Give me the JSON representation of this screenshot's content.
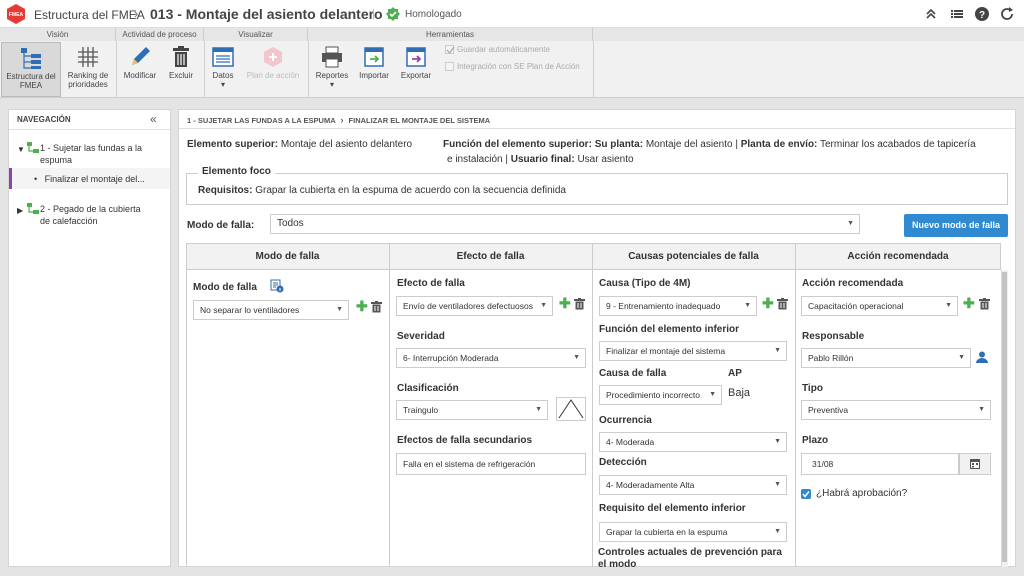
{
  "app": {
    "title": "Estructura del FMEA",
    "crumb_sep": "›",
    "page_title": "013 - Montaje del asiento delantero",
    "pipe": "|",
    "status": "Homologado",
    "logo_text": "FMEA"
  },
  "ribbon": {
    "groups": [
      "Visión",
      "Actividad de proceso",
      "Visualizar",
      "Herramientas"
    ],
    "buttons": {
      "estructura": [
        "Estructura del",
        "FMEA"
      ],
      "ranking": [
        "Ranking de",
        "prioridades"
      ],
      "modificar": "Modificar",
      "excluir": "Excluir",
      "datos": "Datos",
      "plan": "Plan de acción",
      "reportes": "Reportes",
      "importar": "Importar",
      "exportar": "Exportar"
    },
    "checks": [
      "Guardar automáticamente",
      "Integración con SE Plan de Acción"
    ]
  },
  "nav": {
    "title": "NAVEGACIÓN",
    "collapse": "«",
    "items": [
      {
        "label_1": "1 - Sujetar las fundas a la",
        "label_2": "espuma"
      },
      {
        "label_1": "Finalizar el montaje del..."
      },
      {
        "label_1": "2 - Pegado de la cubierta",
        "label_2": "de calefacción"
      }
    ]
  },
  "main": {
    "breadcrumb_1": "1 - SUJETAR LAS FUNDAS A LA ESPUMA",
    "breadcrumb_sep": "›",
    "breadcrumb_2": "FINALIZAR EL MONTAJE DEL SISTEMA",
    "superior_label": "Elemento superior:",
    "superior_value": "Montaje del asiento delantero",
    "funcion_label": "Función del elemento superior:",
    "su_planta_label": "Su planta:",
    "su_planta_value": "Montaje del asiento |",
    "planta_envio_label": "Planta de envío:",
    "planta_envio_value": "Terminar los acabados de tapicería",
    "line2_value": "e instalación |",
    "usuario_label": "Usuario final:",
    "usuario_value": "Usar asiento",
    "foco_title": "Elemento foco",
    "requisitos_label": "Requisitos:",
    "requisitos_value": "Grapar la cubierta en la espuma de acuerdo con la secuencia definida",
    "modo_falla_label": "Modo de falla:",
    "modo_falla_value": "Todos",
    "nuevo_btn": "Nuevo modo de falla",
    "columns": [
      "Modo de falla",
      "Efecto de falla",
      "Causas potenciales de falla",
      "Acción recomendada"
    ]
  },
  "col1": {
    "label": "Modo de falla",
    "value": "No separar lo ventiladores"
  },
  "col2": {
    "efecto_label": "Efecto de falla",
    "efecto_value": "Envío de ventiladores defectuosos",
    "severidad_label": "Severidad",
    "severidad_value": "6- Interrupción Moderada",
    "clasif_label": "Clasificación",
    "clasif_value": "Traingulo",
    "secundarios_label": "Efectos de falla secundarios",
    "secundarios_value": "Falla en el sistema de refrigeración"
  },
  "col3": {
    "causa_label": "Causa (Tipo de 4M)",
    "causa_value": "9 - Entrenamiento  inadequado",
    "funcion_label": "Función del elemento inferior",
    "funcion_value": "Finalizar el montaje del sistema",
    "causa_falla_label": "Causa de falla",
    "causa_falla_value": "Procedimiento incorrecto",
    "ap_label": "AP",
    "ap_value": "Baja",
    "ocurrencia_label": "Ocurrencia",
    "ocurrencia_value": "4- Moderada",
    "deteccion_label": "Detección",
    "deteccion_value": "4- Moderadamente Alta",
    "requisito_label": "Requisito del elemento inferior",
    "requisito_value": "Grapar la cubierta en la espuma",
    "controles_label_1": "Controles actuales de prevención para",
    "controles_label_2": "el modo"
  },
  "col4": {
    "accion_label": "Acción recomendada",
    "accion_value": "Capacitación operacional",
    "responsable_label": "Responsable",
    "responsable_value": "Pablo Rillón",
    "tipo_label": "Tipo",
    "tipo_value": "Preventiva",
    "plazo_label": "Plazo",
    "plazo_value": "31/08",
    "aprobacion_label": "¿Habrá aprobación?"
  },
  "colors": {
    "accent": "#2f8ad1",
    "add": "#4caf50",
    "brand": "#e53935",
    "nav_selected_border": "#8e44ad"
  }
}
